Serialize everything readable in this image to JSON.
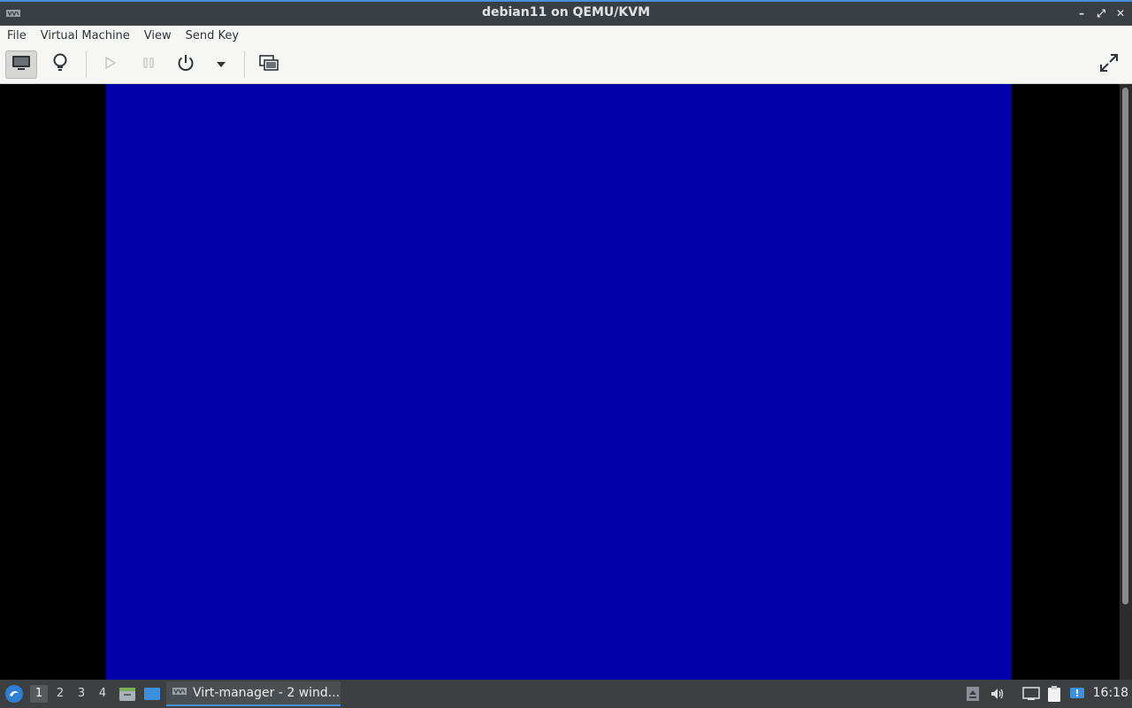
{
  "window": {
    "title": "debian11 on QEMU/KVM",
    "controls": {
      "minimize": "–",
      "maximize": "⤢",
      "close": "✕"
    }
  },
  "menubar": {
    "items": [
      "File",
      "Virtual Machine",
      "View",
      "Send Key"
    ]
  },
  "toolbar": {
    "buttons": [
      {
        "name": "console-view",
        "icon": "monitor-icon",
        "active": true
      },
      {
        "name": "details-view",
        "icon": "lightbulb-icon",
        "active": false
      },
      {
        "name": "run",
        "icon": "play-icon",
        "enabled": false
      },
      {
        "name": "pause",
        "icon": "pause-icon",
        "enabled": false
      },
      {
        "name": "shutdown",
        "icon": "power-icon",
        "enabled": true
      },
      {
        "name": "shutdown-menu",
        "icon": "dropdown-arrow-icon",
        "enabled": true
      },
      {
        "name": "snapshots",
        "icon": "snapshots-icon",
        "enabled": true
      },
      {
        "name": "fullscreen",
        "icon": "fullscreen-icon",
        "enabled": true
      }
    ]
  },
  "display": {
    "guest_screen_color": "#0000aa"
  },
  "taskbar": {
    "workspaces": [
      "1",
      "2",
      "3",
      "4"
    ],
    "current_workspace": "1",
    "task_label": "Virt-manager - 2 wind...",
    "clock": "16:18"
  },
  "colors": {
    "accent": "#4a90d9",
    "titlebar": "#3a3f44",
    "taskbar": "#3c4043"
  }
}
